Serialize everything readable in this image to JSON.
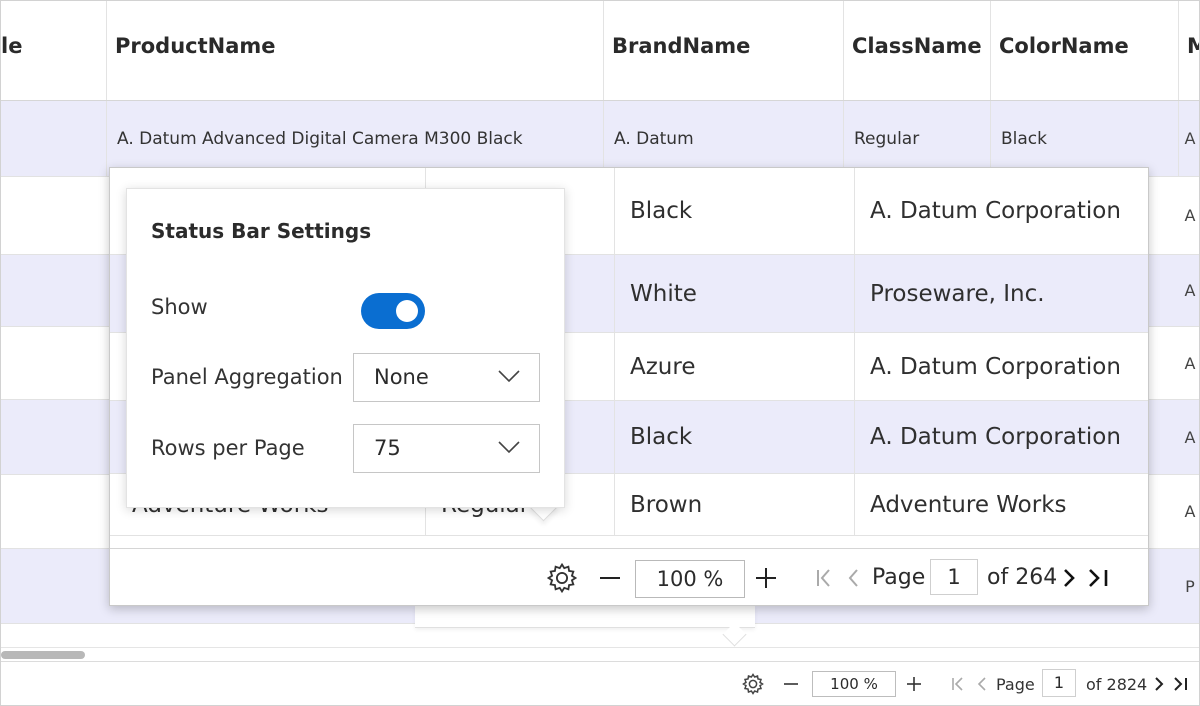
{
  "grid": {
    "columns": [
      {
        "label": "le"
      },
      {
        "label": "ProductName"
      },
      {
        "label": "BrandName"
      },
      {
        "label": "ClassName"
      },
      {
        "label": "ColorName"
      },
      {
        "label": "M"
      }
    ],
    "first_row": {
      "product": "A. Datum Advanced Digital Camera M300 Black",
      "brand": "A. Datum",
      "class": "Regular",
      "color": "Black",
      "edge": "A"
    },
    "edge_letters": [
      "A",
      "A",
      "A",
      "A",
      "A",
      "P"
    ]
  },
  "zoomed_grid": {
    "rows": [
      {
        "col1": "",
        "col2": "",
        "color": "Black",
        "manufacturer": "A. Datum Corporation"
      },
      {
        "col1": "",
        "col2": "",
        "color": "White",
        "manufacturer": "Proseware, Inc."
      },
      {
        "col1": "",
        "col2": "",
        "color": "Azure",
        "manufacturer": "A. Datum Corporation"
      },
      {
        "col1": "",
        "col2": "",
        "color": "Black",
        "manufacturer": "A. Datum Corporation"
      },
      {
        "col1": "Adventure Works",
        "col2": "Regular",
        "color": "Brown",
        "manufacturer": "Adventure Works"
      }
    ],
    "status_bar": {
      "zoom": "100 %",
      "page_label": "Page",
      "page_value": "1",
      "of_pages": "of 264"
    }
  },
  "settings": {
    "title": "Status Bar Settings",
    "show_label": "Show",
    "show_on": true,
    "panel_aggregation_label": "Panel Aggregation",
    "panel_aggregation_value": "None",
    "rows_per_page_label": "Rows per Page",
    "rows_per_page_value": "75",
    "accent_color": "#0a6ed1"
  },
  "status_bar": {
    "zoom": "100 %",
    "page_label": "Page",
    "page_value": "1",
    "of_pages": "of 2824"
  },
  "icons": {
    "settings": "gear-icon",
    "zoom_out": "minus-icon",
    "zoom_in": "plus-icon",
    "first_page": "first-page-icon",
    "prev_page": "prev-page-icon",
    "next_page": "next-page-icon",
    "last_page": "last-page-icon",
    "dropdown": "chevron-down-icon"
  }
}
